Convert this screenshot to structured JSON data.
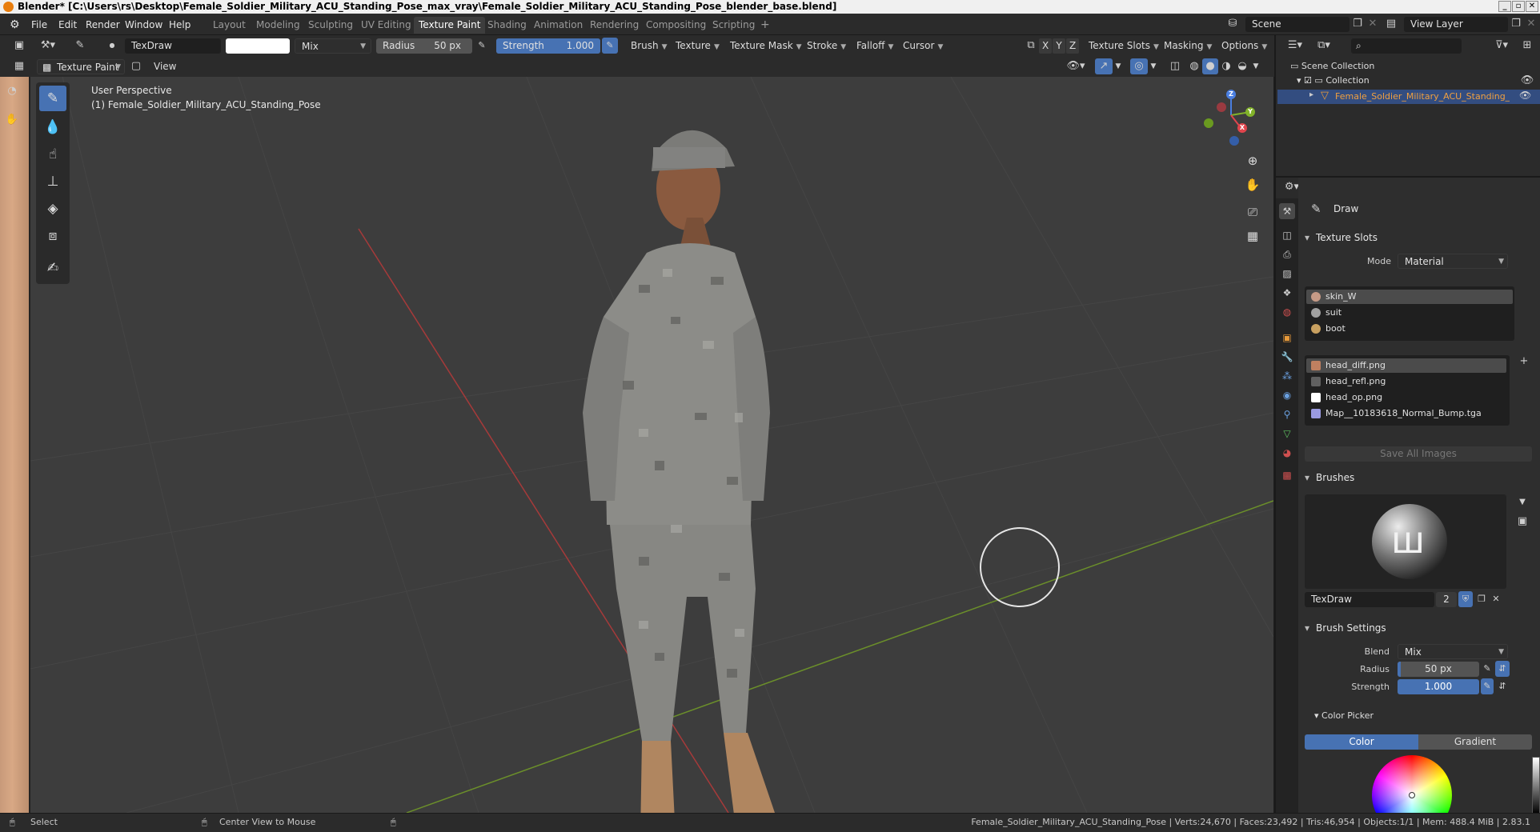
{
  "window": {
    "title": "Blender* [C:\\Users\\rs\\Desktop\\Female_Soldier_Military_ACU_Standing_Pose_max_vray\\Female_Soldier_Military_ACU_Standing_Pose_blender_base.blend]",
    "minimize": "_",
    "maximize": "▫",
    "close": "✕"
  },
  "menu": [
    "File",
    "Edit",
    "Render",
    "Window",
    "Help"
  ],
  "workspaces": [
    "Layout",
    "Modeling",
    "Sculpting",
    "UV Editing",
    "Texture Paint",
    "Shading",
    "Animation",
    "Rendering",
    "Compositing",
    "Scripting"
  ],
  "workspace_add": "+",
  "scene": {
    "name": "Scene",
    "view_layer": "View Layer"
  },
  "tool_header": {
    "brush_name": "TexDraw",
    "blend": "Mix",
    "radius_label": "Radius",
    "radius_value": "50 px",
    "strength_label": "Strength",
    "strength_value": "1.000",
    "strength_fraction": 1.0,
    "menus": [
      "Brush",
      "Texture",
      "Texture Mask",
      "Stroke",
      "Falloff",
      "Cursor"
    ],
    "axes": [
      "X",
      "Y",
      "Z"
    ],
    "right_menus": [
      "Texture Slots",
      "Masking",
      "Options"
    ],
    "color_hex": "#ffffff"
  },
  "editor_header": {
    "mode": "Texture Paint",
    "view": "View"
  },
  "viewport": {
    "perspective": "User Perspective",
    "object_label": "(1) Female_Soldier_Military_ACU_Standing_Pose",
    "background": "#3d3d3d",
    "x_axis_color": "#a63a3a",
    "y_axis_color": "#6b8f2a"
  },
  "gizmo": {
    "x": "X",
    "y": "Y",
    "z": "Z"
  },
  "outliner": {
    "root": "Scene Collection",
    "collection": "Collection",
    "object": "Female_Soldier_Military_ACU_Standing_Pose"
  },
  "properties": {
    "tool_name": "Draw",
    "texture_slots": {
      "title": "Texture Slots",
      "mode_label": "Mode",
      "mode_value": "Material",
      "materials": [
        "skin_W",
        "suit",
        "boot"
      ],
      "images": [
        "head_diff.png",
        "head_refl.png",
        "head_op.png",
        "Map__10183618_Normal_Bump.tga"
      ],
      "save_all": "Save All Images"
    },
    "brushes": {
      "title": "Brushes",
      "brush_name": "TexDraw",
      "users": "2"
    },
    "brush_settings": {
      "title": "Brush Settings",
      "blend_label": "Blend",
      "blend_value": "Mix",
      "radius_label": "Radius",
      "radius_value": "50 px",
      "strength_label": "Strength",
      "strength_value": "1.000"
    },
    "color_picker": {
      "title": "Color Picker",
      "tab_color": "Color",
      "tab_gradient": "Gradient"
    }
  },
  "statusbar": {
    "select": "Select",
    "center_view": "Center View to Mouse",
    "stats": "Female_Soldier_Military_ACU_Standing_Pose | Verts:24,670 | Faces:23,492 | Tris:46,954 | Objects:1/1 | Mem: 488.4 MiB | 2.83.1"
  }
}
